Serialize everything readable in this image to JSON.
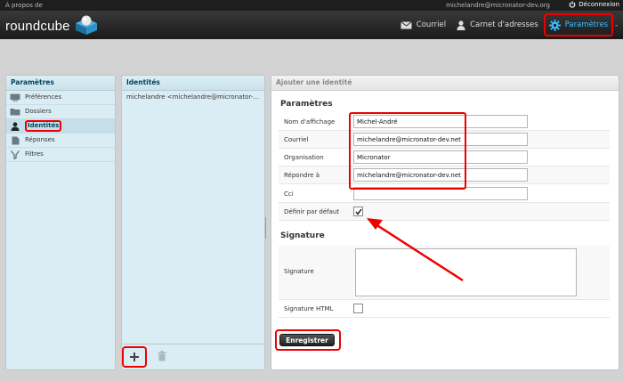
{
  "topbar": {
    "about": "À propos de",
    "user_email": "michelandre@micronator-dev.org",
    "logout": "Déconnexion"
  },
  "header": {
    "logo_text": "roundcube"
  },
  "nav": [
    {
      "label": "Courriel",
      "icon": "envelope-icon"
    },
    {
      "label": "Carnet d'adresses",
      "icon": "person-icon"
    },
    {
      "label": "Paramètres",
      "icon": "gear-icon",
      "active": true
    }
  ],
  "nav_trailing": "-",
  "settings_panel": {
    "title": "Paramètres",
    "items": [
      {
        "label": "Préférences",
        "icon": "monitor-icon"
      },
      {
        "label": "Dossiers",
        "icon": "folder-icon"
      },
      {
        "label": "Identités",
        "icon": "person-icon",
        "selected": true
      },
      {
        "label": "Réponses",
        "icon": "document-icon"
      },
      {
        "label": "Filtres",
        "icon": "funnel-icon"
      }
    ]
  },
  "identities_panel": {
    "title": "Identités",
    "items": [
      "michelandre <michelandre@micronator-..."
    ]
  },
  "form_panel": {
    "title": "Ajouter une identité",
    "section_params": "Paramètres",
    "fields": {
      "display_name": {
        "label": "Nom d'affichage",
        "value": "Michel-André"
      },
      "email": {
        "label": "Courriel",
        "value": "michelandre@micronator-dev.net"
      },
      "organization": {
        "label": "Organisation",
        "value": "Micronator"
      },
      "reply_to": {
        "label": "Répondre à",
        "value": "michelandre@micronator-dev.net"
      },
      "bcc": {
        "label": "Cci",
        "value": ""
      },
      "default": {
        "label": "Définir par défaut",
        "checked": true
      }
    },
    "section_signature": "Signature",
    "signature": {
      "label": "Signature",
      "value": ""
    },
    "html_signature": {
      "label": "Signature HTML",
      "checked": false
    },
    "save_label": "Enregistrer"
  },
  "colors": {
    "accent": "#37beff",
    "highlight": "#e00000",
    "panel_bg": "#dbedf4"
  }
}
